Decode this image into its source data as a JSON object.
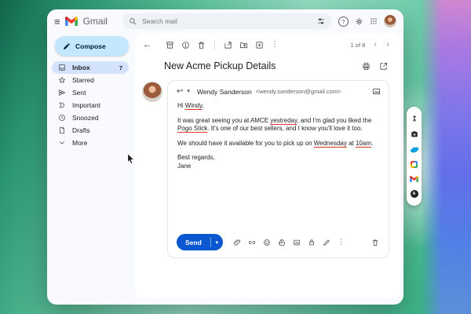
{
  "header": {
    "app_name": "Gmail",
    "search_placeholder": "Search mail"
  },
  "sidebar": {
    "compose_label": "Compose",
    "items": [
      {
        "label": "Inbox",
        "count": "7"
      },
      {
        "label": "Starred"
      },
      {
        "label": "Sent"
      },
      {
        "label": "Important"
      },
      {
        "label": "Snoozed"
      },
      {
        "label": "Drafts"
      },
      {
        "label": "More"
      }
    ]
  },
  "toolbar": {
    "pagination": "1 of 8"
  },
  "email": {
    "subject": "New Acme Pickup Details",
    "sender_name": "Wendy Sanderson",
    "sender_email": "<wendy.sanderson@gmail.com>",
    "body": {
      "greeting_pre": "Hi ",
      "greeting_name": "Windy",
      "greeting_post": ",",
      "p1_a": "It was great seeing you at AMCE ",
      "p1_typo": "yestreday",
      "p1_b": ", and I'm glad you liked the ",
      "p1_product": "Pogo Stick",
      "p1_c": ". It's one of our best sellers, and I know you'll love it too.",
      "p2_a": "We should have it available for you to pick up on ",
      "p2_day": "Wednesday",
      "p2_b": " at ",
      "p2_time": "10am",
      "p2_c": ".",
      "closing": "Best regards,",
      "signature": "Jane"
    },
    "send_label": "Send"
  },
  "icons": {
    "hamburger": "≡",
    "help": "?",
    "back": "←",
    "more_vertical": "⋮",
    "prev": "‹",
    "next": "›",
    "reply": "↩",
    "dropdown_caret": "▾",
    "send_caret": "▾",
    "app_letter": "A"
  },
  "colors": {
    "accent_blue": "#0b57d0",
    "compose_bg": "#c2e7ff",
    "selected_item_bg": "#d3e3fd",
    "spellcheck_red": "#d93025",
    "salesforce_blue": "#00a1e0",
    "gmail_red": "#ea4335"
  }
}
